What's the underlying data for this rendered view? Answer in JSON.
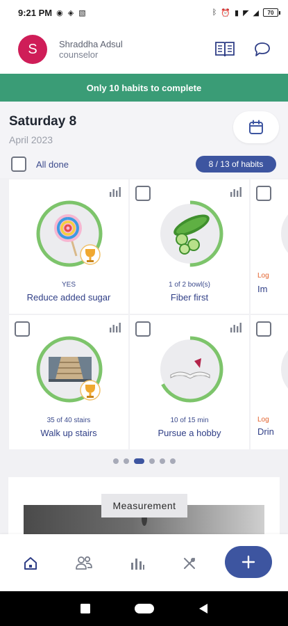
{
  "status_bar": {
    "time": "9:21 PM",
    "battery": "70"
  },
  "header": {
    "avatar_letter": "S",
    "user_name": "Shraddha Adsul",
    "user_role": "counselor"
  },
  "banner": {
    "text": "Only 10 habits to complete"
  },
  "date": {
    "day": "Saturday 8",
    "month_year": "April 2023"
  },
  "all_done": {
    "label": "All done"
  },
  "habit_count": {
    "text": "8 / 13 of habits"
  },
  "habits": [
    {
      "progress_text": "YES",
      "name": "Reduce added sugar",
      "progress": 1.0,
      "trophy": true,
      "image": "lollipop"
    },
    {
      "progress_text": "1 of 2 bowl(s)",
      "name": "Fiber first",
      "progress": 0.5,
      "trophy": false,
      "image": "cucumber"
    },
    {
      "progress_text": "35 of 40 stairs",
      "name": "Walk up stairs",
      "progress": 1.0,
      "trophy": true,
      "image": "stairs"
    },
    {
      "progress_text": "10 of 15 min",
      "name": "Pursue a hobby",
      "progress": 0.67,
      "trophy": false,
      "image": "book"
    }
  ],
  "partial_habits": [
    {
      "label": "Log",
      "name": "Im"
    },
    {
      "label": "Log",
      "name": "Drin"
    }
  ],
  "pager": {
    "count": 6,
    "active_index": 2
  },
  "measurement": {
    "label": "Measurement"
  },
  "colors": {
    "accent": "#3d55a0",
    "banner": "#3a9c76",
    "ring": "#7dc46b",
    "avatar": "#cf1d58"
  }
}
